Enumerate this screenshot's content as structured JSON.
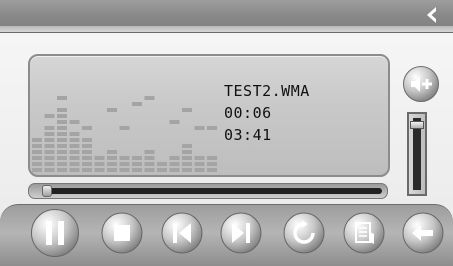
{
  "track": {
    "filename": "TEST2.WMA",
    "elapsed": "00:06",
    "duration": "03:41"
  },
  "progress": {
    "fraction": 0.027
  },
  "volume": {
    "level": 0.92
  },
  "equalizer": {
    "bars": [
      6,
      8,
      11,
      7,
      6,
      3,
      4,
      3,
      3,
      4,
      2,
      3,
      5,
      3,
      3
    ],
    "peaks": [
      null,
      9,
      12,
      8,
      7,
      null,
      10,
      7,
      11,
      12,
      null,
      8,
      10,
      7,
      7
    ]
  },
  "icons": {
    "back": "back-arrow-icon",
    "volume": "volume-up-icon",
    "pause": "pause-icon",
    "stop": "stop-icon",
    "previous": "previous-track-icon",
    "next": "next-track-icon",
    "repeat": "repeat-icon",
    "playlist": "playlist-icon",
    "exit": "exit-icon"
  },
  "colors": {
    "eq_bar": "#a4a4a4",
    "lcd": "#c9c9c9",
    "button_light": "#ffffff",
    "button_dark": "#8e8e8e"
  }
}
